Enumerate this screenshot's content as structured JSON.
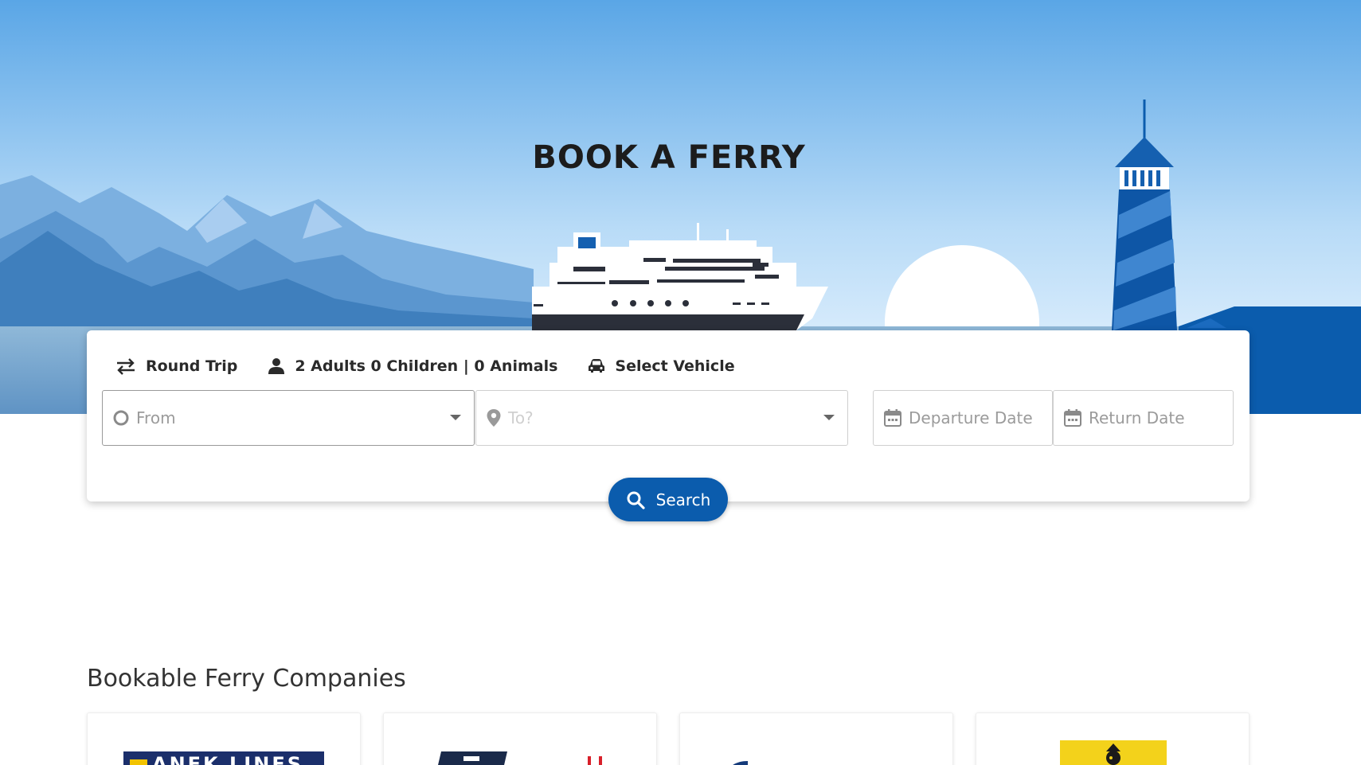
{
  "hero": {
    "title": "BOOK A FERRY"
  },
  "booking": {
    "trip_type": "Round Trip",
    "passengers": "2 Adults 0 Children | 0 Animals",
    "vehicle": "Select Vehicle",
    "from_placeholder": "From",
    "to_placeholder": "To?",
    "departure_placeholder": "Departure Date",
    "return_placeholder": "Return Date",
    "search_label": "Search"
  },
  "companies": {
    "title": "Bookable Ferry Companies",
    "items": [
      {
        "logo_text": "ANEK LINES"
      },
      {
        "logo_text": ""
      },
      {
        "logo_text": ""
      },
      {
        "logo_text": ""
      }
    ]
  },
  "colors": {
    "brand_blue": "#0b5cad",
    "sky_top": "#5aa6e6",
    "sky_bottom": "#dceefc"
  }
}
